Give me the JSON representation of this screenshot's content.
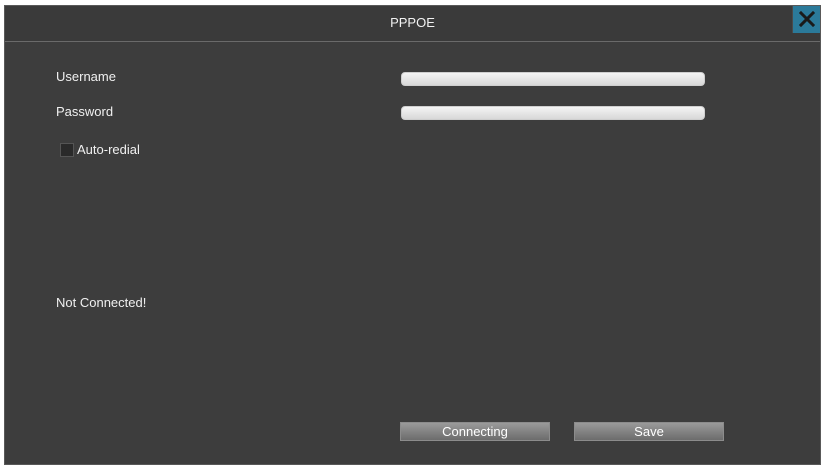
{
  "window": {
    "title": "PPPOE",
    "close_icon": "close-icon"
  },
  "form": {
    "username_label": "Username",
    "username_value": "",
    "password_label": "Password",
    "password_value": "",
    "autoredial_label": "Auto-redial",
    "autoredial_checked": false
  },
  "status": {
    "text": "Not Connected!"
  },
  "buttons": {
    "connect_label": "Connecting",
    "save_label": "Save"
  },
  "colors": {
    "background": "#3d3d3d",
    "close_button": "#2b7a9a",
    "text": "#f0f0f0"
  }
}
